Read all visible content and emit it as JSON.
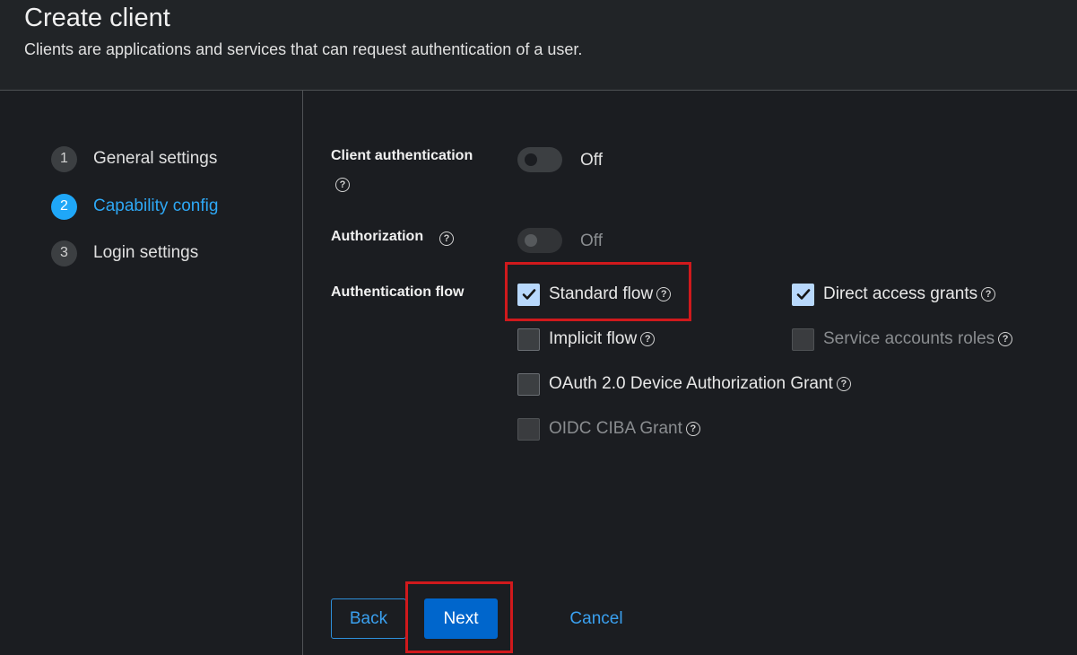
{
  "header": {
    "title": "Create client",
    "description": "Clients are applications and services that can request authentication of a user."
  },
  "wizard": {
    "steps": [
      {
        "number": "1",
        "label": "General settings",
        "state": "completed"
      },
      {
        "number": "2",
        "label": "Capability config",
        "state": "current"
      },
      {
        "number": "3",
        "label": "Login settings",
        "state": "pending"
      }
    ]
  },
  "form": {
    "client_authentication": {
      "label": "Client authentication",
      "value": false,
      "state_text": "Off"
    },
    "authorization": {
      "label": "Authorization",
      "value": false,
      "state_text": "Off",
      "disabled": true
    },
    "authentication_flow": {
      "label": "Authentication flow",
      "options": [
        {
          "label": "Standard flow",
          "checked": true,
          "disabled": false,
          "highlighted": true
        },
        {
          "label": "Direct access grants",
          "checked": true,
          "disabled": false
        },
        {
          "label": "Implicit flow",
          "checked": false,
          "disabled": false
        },
        {
          "label": "Service accounts roles",
          "checked": false,
          "disabled": true
        },
        {
          "label": "OAuth 2.0 Device Authorization Grant",
          "checked": false,
          "disabled": false
        },
        {
          "label": "OIDC CIBA Grant",
          "checked": false,
          "disabled": true
        }
      ]
    }
  },
  "buttons": {
    "back": "Back",
    "next": "Next",
    "cancel": "Cancel"
  },
  "icons": {
    "help": "?"
  },
  "colors": {
    "background": "#1b1d21",
    "accent": "#0066cc",
    "link": "#3aa0ef",
    "current_step": "#1fa7f8",
    "checkbox_checked": "#b8d8fc",
    "highlight_annotation": "#d0191c"
  }
}
